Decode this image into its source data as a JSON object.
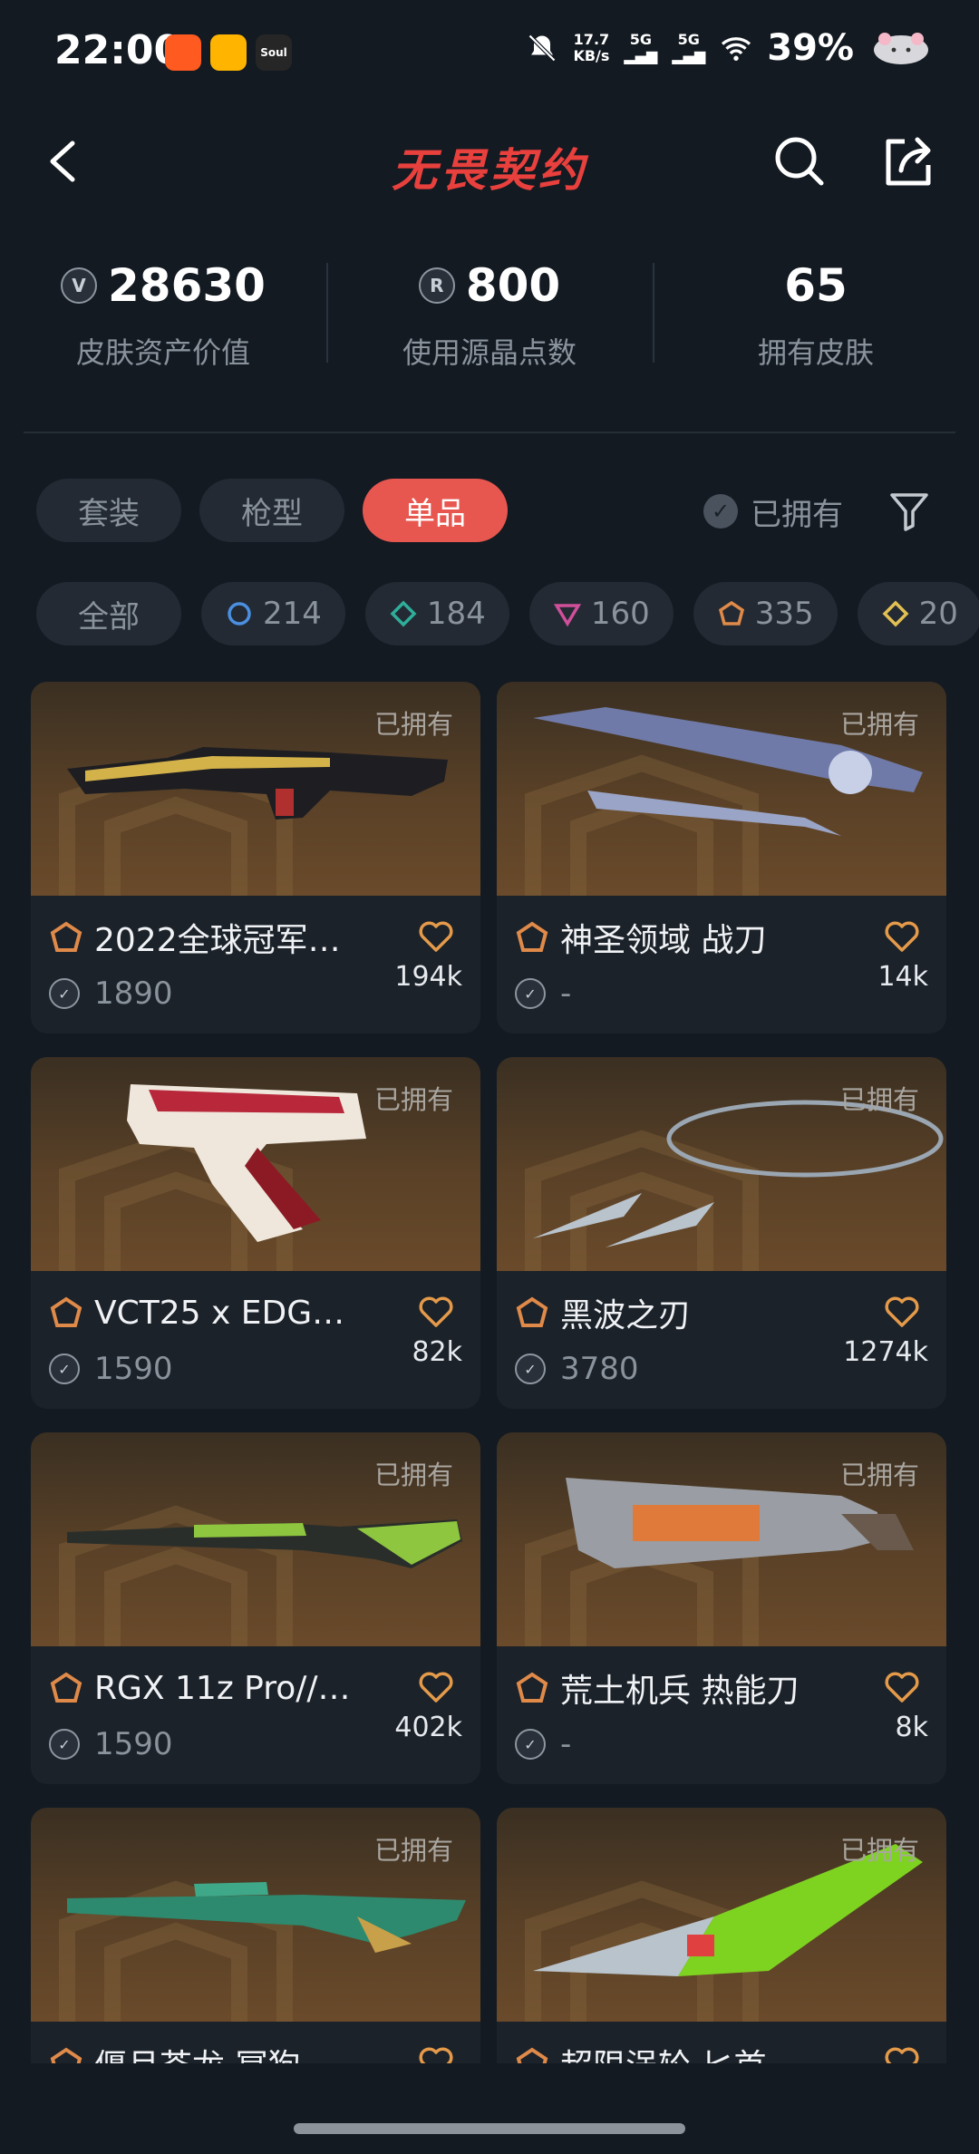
{
  "status_bar": {
    "time": "22:00",
    "net_speed": "17.7",
    "net_unit": "KB/s",
    "sig1": "5G",
    "sig2": "5G",
    "battery": "39%",
    "apps": [
      {
        "name": "taobao-app-icon",
        "color": "#ff5a1f",
        "label": ""
      },
      {
        "name": "weibo-app-icon",
        "color": "#ffb400",
        "label": ""
      },
      {
        "name": "soul-app-icon",
        "color": "#262626",
        "label": "Soul"
      }
    ]
  },
  "header": {
    "brand": "无畏契约"
  },
  "stats": [
    {
      "value": "28630",
      "label": "皮肤资产价值",
      "icon": "vp-coin-icon",
      "glyph": "V"
    },
    {
      "value": "800",
      "label": "使用源晶点数",
      "icon": "radianite-coin-icon",
      "glyph": "R"
    },
    {
      "value": "65",
      "label": "拥有皮肤",
      "icon": "",
      "glyph": ""
    }
  ],
  "tabs": [
    {
      "label": "套装",
      "active": false
    },
    {
      "label": "枪型",
      "active": false
    },
    {
      "label": "单品",
      "active": true
    }
  ],
  "owned_filter": {
    "label": "已拥有"
  },
  "chips": [
    {
      "label": "全部",
      "icon": "",
      "color": ""
    },
    {
      "label": "214",
      "icon": "select-tier-icon",
      "color": "#4a8fe0"
    },
    {
      "label": "184",
      "icon": "deluxe-tier-icon",
      "color": "#2fae9a"
    },
    {
      "label": "160",
      "icon": "premium-tier-icon",
      "color": "#d04f9a"
    },
    {
      "label": "335",
      "icon": "exclusive-tier-icon",
      "color": "#e08a4a"
    },
    {
      "label": "20",
      "icon": "ultra-tier-icon",
      "color": "#e3c054"
    }
  ],
  "cards": [
    {
      "name": "2022全球冠军…",
      "price": "1890",
      "likes": "194k",
      "owned": "已拥有",
      "weapon": "rifle",
      "accent": "#d4b24a"
    },
    {
      "name": "神圣领域 战刀",
      "price": "-",
      "likes": "14k",
      "owned": "已拥有",
      "weapon": "sword",
      "accent": "#8fa0d0"
    },
    {
      "name": "VCT25 x EDG…",
      "price": "1590",
      "likes": "82k",
      "owned": "已拥有",
      "weapon": "pistol",
      "accent": "#b8283a"
    },
    {
      "name": "黑波之刃",
      "price": "3780",
      "likes": "1274k",
      "owned": "已拥有",
      "weapon": "kunai",
      "accent": "#9aa6b2"
    },
    {
      "name": "RGX 11z Pro//3…",
      "price": "1590",
      "likes": "402k",
      "owned": "已拥有",
      "weapon": "shotgun",
      "accent": "#8ec63f"
    },
    {
      "name": "荒土机兵 热能刀",
      "price": "-",
      "likes": "8k",
      "owned": "已拥有",
      "weapon": "cleaver",
      "accent": "#e07a3a"
    },
    {
      "name": "偃月苍龙 冥狗",
      "price": "",
      "likes": "",
      "owned": "已拥有",
      "weapon": "sniper",
      "accent": "#3fa889"
    },
    {
      "name": "超限涡轮 匕首",
      "price": "",
      "likes": "",
      "owned": "已拥有",
      "weapon": "knife",
      "accent": "#7ed321"
    }
  ]
}
